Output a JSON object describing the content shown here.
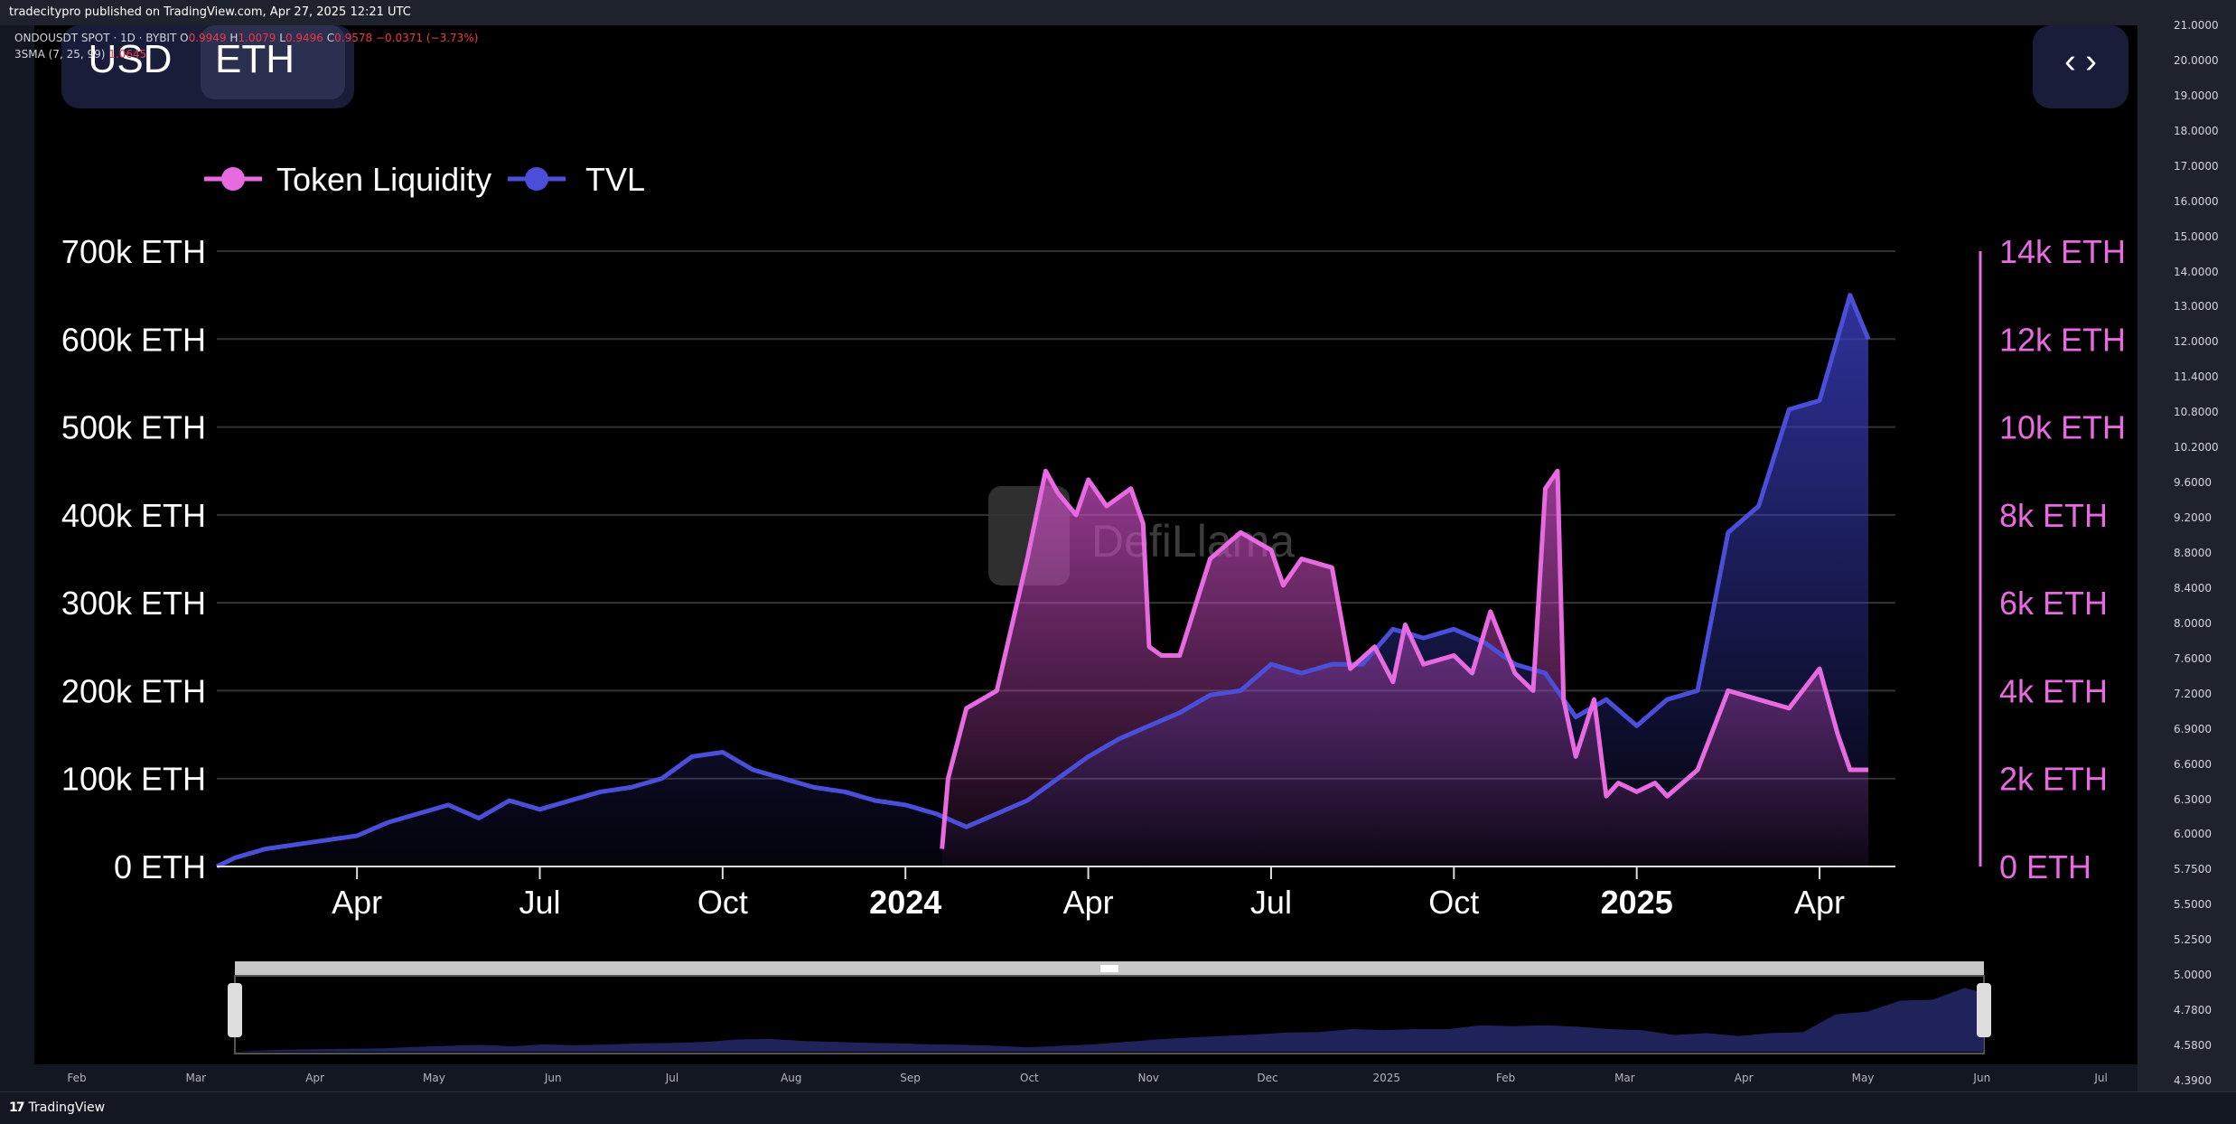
{
  "header": {
    "published": "tradecitypro published on TradingView.com, Apr 27, 2025 12:21 UTC"
  },
  "legend": {
    "symbol": "ONDOUSDT SPOT · 1D · BYBIT",
    "o_label": "O",
    "o_value": "0.9949",
    "h_label": "H",
    "h_value": "1.0079",
    "l_label": "L",
    "l_value": "0.9496",
    "c_label": "C",
    "c_value": "0.9578",
    "change": "−0.0371 (−3.73%)",
    "indicator": "3SMA (7, 25, 99)",
    "indicator_value": "1.0645"
  },
  "embedded": {
    "currency_toggle": [
      "USD",
      "ETH"
    ],
    "selected_currency": "ETH",
    "embed_icon": "code-icon",
    "watermark": "DefiLlama",
    "legend": [
      {
        "name": "Token Liquidity",
        "color": "#e86ae0"
      },
      {
        "name": "TVL",
        "color": "#4a4ed8"
      }
    ]
  },
  "price_scale": [
    "21.0000",
    "20.0000",
    "19.0000",
    "18.0000",
    "17.0000",
    "16.0000",
    "15.0000",
    "14.0000",
    "13.0000",
    "12.0000",
    "11.4000",
    "10.8000",
    "10.2000",
    "9.6000",
    "9.2000",
    "8.8000",
    "8.4000",
    "8.0000",
    "7.6000",
    "7.2000",
    "6.9000",
    "6.6000",
    "6.3000",
    "6.0000",
    "5.7500",
    "5.5000",
    "5.2500",
    "5.0000",
    "4.7800",
    "4.5800",
    "4.3900"
  ],
  "time_axis": [
    "Feb",
    "Mar",
    "Apr",
    "May",
    "Jun",
    "Jul",
    "Aug",
    "Sep",
    "Oct",
    "Nov",
    "Dec",
    "2025",
    "Feb",
    "Mar",
    "Apr",
    "May",
    "Jun",
    "Jul"
  ],
  "footer": {
    "brand": "TradingView",
    "logo_icon": "tradingview-logo-icon"
  },
  "chart_data": {
    "type": "line",
    "left_axis": {
      "ticks": [
        "0 ETH",
        "100k ETH",
        "200k ETH",
        "300k ETH",
        "400k ETH",
        "500k ETH",
        "600k ETH",
        "700k ETH"
      ],
      "ylim": [
        0,
        700000
      ]
    },
    "right_axis": {
      "ticks": [
        "0 ETH",
        "2k ETH",
        "4k ETH",
        "6k ETH",
        "8k ETH",
        "10k ETH",
        "12k ETH",
        "14k ETH"
      ],
      "ylim": [
        0,
        14000
      ]
    },
    "x_ticks": [
      "Apr",
      "Jul",
      "Oct",
      "2024",
      "Apr",
      "Jul",
      "Oct",
      "2025",
      "Apr"
    ],
    "x_tick_months": [
      2,
      5,
      8,
      11,
      14,
      17,
      20,
      23,
      26
    ],
    "xlim": [
      -0.3,
      26.8
    ],
    "grid": true,
    "legend_position": "top-left",
    "series": [
      {
        "name": "TVL",
        "axis": "left",
        "color": "#4a4ed8",
        "x": [
          -0.3,
          0,
          0.5,
          1,
          1.5,
          2,
          2.5,
          3,
          3.5,
          4,
          4.5,
          5,
          5.5,
          6,
          6.5,
          7,
          7.5,
          8,
          8.5,
          9,
          9.5,
          10,
          10.5,
          11,
          11.5,
          12,
          12.5,
          13,
          13.5,
          14,
          14.5,
          15,
          15.5,
          16,
          16.5,
          17,
          17.5,
          18,
          18.5,
          19,
          19.5,
          20,
          20.5,
          21,
          21.5,
          22,
          22.5,
          23,
          23.5,
          24,
          24.5,
          25,
          25.5,
          26,
          26.5,
          26.8
        ],
        "y": [
          0,
          10000,
          20000,
          25000,
          30000,
          35000,
          50000,
          60000,
          70000,
          55000,
          75000,
          65000,
          75000,
          85000,
          90000,
          100000,
          125000,
          130000,
          110000,
          100000,
          90000,
          85000,
          75000,
          70000,
          60000,
          45000,
          60000,
          75000,
          100000,
          125000,
          145000,
          160000,
          175000,
          195000,
          200000,
          230000,
          220000,
          230000,
          230000,
          270000,
          260000,
          270000,
          255000,
          230000,
          220000,
          170000,
          190000,
          160000,
          190000,
          200000,
          380000,
          410000,
          520000,
          530000,
          650000,
          600000
        ]
      },
      {
        "name": "Token Liquidity",
        "axis": "right",
        "color": "#e86ae0",
        "x": [
          11.6,
          11.7,
          12,
          12.5,
          13,
          13.3,
          13.5,
          13.8,
          14,
          14.3,
          14.7,
          14.9,
          15,
          15.2,
          15.5,
          16,
          16.5,
          17,
          17.2,
          17.5,
          18,
          18.3,
          18.7,
          19,
          19.2,
          19.5,
          20,
          20.3,
          20.6,
          21,
          21.3,
          21.5,
          21.7,
          21.8,
          22,
          22.3,
          22.5,
          22.7,
          23,
          23.3,
          23.5,
          24,
          24.5,
          25,
          25.5,
          26,
          26.3,
          26.5,
          26.8
        ],
        "y": [
          400,
          2000,
          3600,
          4000,
          7000,
          9000,
          8500,
          8000,
          8800,
          8200,
          8600,
          7800,
          5000,
          4800,
          4800,
          7000,
          7600,
          7200,
          6400,
          7000,
          6800,
          4500,
          5000,
          4200,
          5500,
          4600,
          4800,
          4400,
          5800,
          4400,
          4000,
          8600,
          9000,
          3800,
          2500,
          3800,
          1600,
          1900,
          1700,
          1900,
          1600,
          2200,
          4000,
          3800,
          3600,
          4500,
          3000,
          2200,
          2200
        ]
      }
    ]
  }
}
